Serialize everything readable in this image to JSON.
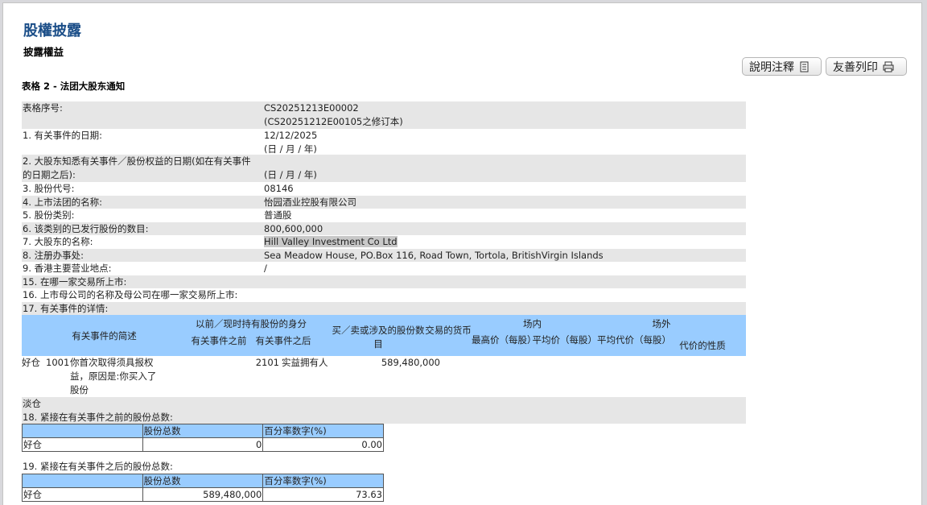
{
  "header": {
    "title": "股權披露",
    "subtitle": "披露權益"
  },
  "toolbar": {
    "notes_label": "說明注釋",
    "print_label": "友善列印"
  },
  "form_title": "表格 2 - 法团大股东通知",
  "fields": {
    "form_no_label": "表格序号:",
    "form_no": "CS20251213E00002",
    "form_no_amend": "(CS20251212E00105之修订本)",
    "event_date_label": "1. 有关事件的日期:",
    "event_date": "12/12/2025",
    "date_format": "(日 / 月 / 年)",
    "aware_date_label_1": "2. 大股东知悉有关事件／股份权益的日期(如在有关事件",
    "aware_date_label_2": "的日期之后):",
    "aware_date_format": "(日 / 月 / 年)",
    "stock_code_label": "3. 股份代号:",
    "stock_code": "08146",
    "issuer_label": "4. 上市法团的名称:",
    "issuer": "怡园酒业控股有限公司",
    "class_label": "5. 股份类别:",
    "class": "普通股",
    "issued_label": "6. 该类别的已发行股份的数目:",
    "issued": "800,600,000",
    "holder_label": "7. 大股东的名称:",
    "holder": "Hill Valley Investment Co Ltd",
    "office_label": "8. 注册办事处:",
    "office": "Sea Meadow House, PO.Box 116, Road Town, Tortola, BritishVirgin Islands",
    "hk_label": "9. 香港主要营业地点:",
    "hk": "/",
    "exchange_label": "15. 在哪一家交易所上市:",
    "parent_label": "16. 上市母公司的名称及母公司在哪一家交易所上市:",
    "details_label": "17. 有关事件的详情:"
  },
  "details": {
    "h_desc": "有关事件的简述",
    "h_capacity": "以前／现时持有股份的身分",
    "h_before": "有关事件之前",
    "h_after": "有关事件之后",
    "h_shares": "买／卖或涉及的股份数目",
    "h_currency": "交易的货币",
    "h_onex": "场内",
    "h_offex": "场外",
    "h_high": "最高价（每股）",
    "h_avg": "平均价（每股）",
    "h_avg_off": "平均代价（每股）",
    "h_nature": "代价的性质",
    "row_pos": "好仓",
    "row_code": "1001",
    "row_desc": "你首次取得须具报权益，原因是:你买入了股份",
    "row_after_code": "2101",
    "row_after": "实益拥有人",
    "row_shares": "589,480,000",
    "short": "淡仓"
  },
  "before": {
    "label": "18. 紧接在有关事件之前的股份总数:",
    "h_total": "股份总数",
    "h_pct": "百分率数字(%)",
    "pos": "好仓",
    "total": "0",
    "pct": "0.00"
  },
  "after": {
    "label": "19. 紧接在有关事件之后的股份总数:",
    "h_total": "股份总数",
    "h_pct": "百分率数字(%)",
    "pos": "好仓",
    "total": "589,480,000",
    "pct": "73.63"
  }
}
